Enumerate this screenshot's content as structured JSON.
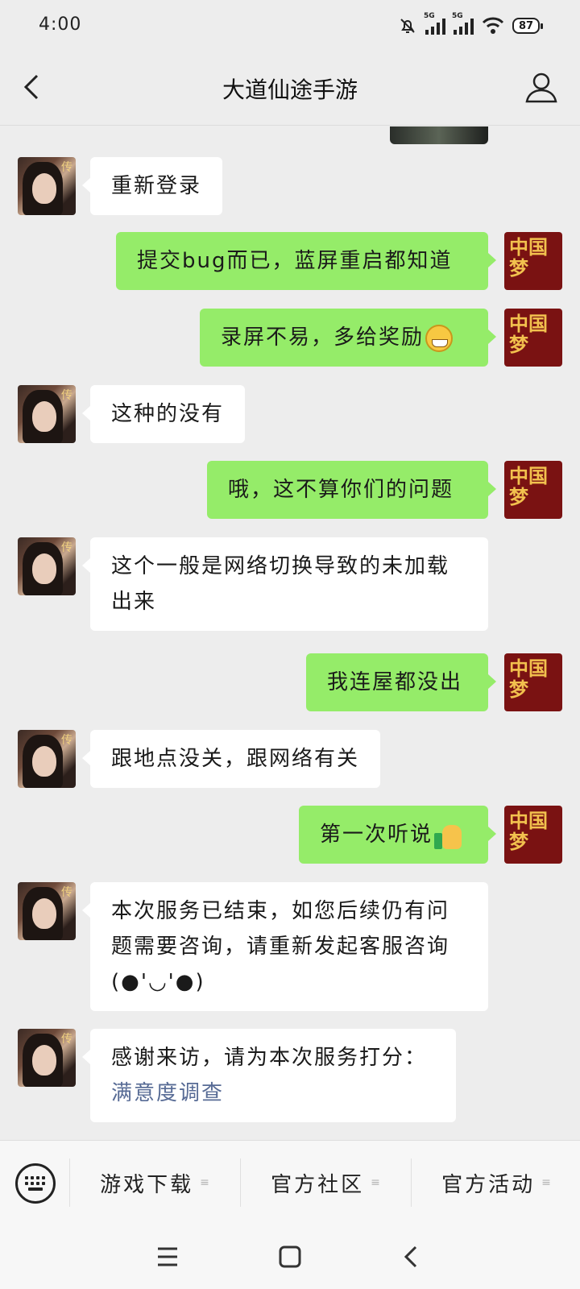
{
  "status": {
    "time": "4:00",
    "battery": "87",
    "network": "5G"
  },
  "header": {
    "title": "大道仙途手游"
  },
  "messages": [
    {
      "side": "left",
      "text": "重新登录"
    },
    {
      "side": "right",
      "text": "提交bug而已，蓝屏重启都知道"
    },
    {
      "side": "right",
      "text": "录屏不易，多给奖励",
      "emoji": "grin-emoji"
    },
    {
      "side": "left",
      "text": "这种的没有"
    },
    {
      "side": "right",
      "text": "哦，这不算你们的问题"
    },
    {
      "side": "left",
      "line1": "这个一般是网络切换导致的未加载",
      "line2": "出来"
    },
    {
      "side": "right",
      "text": "我连屋都没出"
    },
    {
      "side": "left",
      "text": "跟地点没关，跟网络有关"
    },
    {
      "side": "right",
      "text": "第一次听说",
      "emoji": "thumbs-up-emoji"
    },
    {
      "side": "left",
      "line1": "本次服务已结束，如您后续仍有问",
      "line2": "题需要咨询，请重新发起客服咨询",
      "line3": "(●'◡'●)"
    },
    {
      "side": "left",
      "line1": "感谢来访，请为本次服务打分：",
      "link": "满意度调查"
    }
  ],
  "avatars": {
    "right_logo": "中国梦"
  },
  "menu": {
    "items": [
      "游戏下载",
      "官方社区",
      "官方活动"
    ],
    "menu_marker": "≡"
  }
}
